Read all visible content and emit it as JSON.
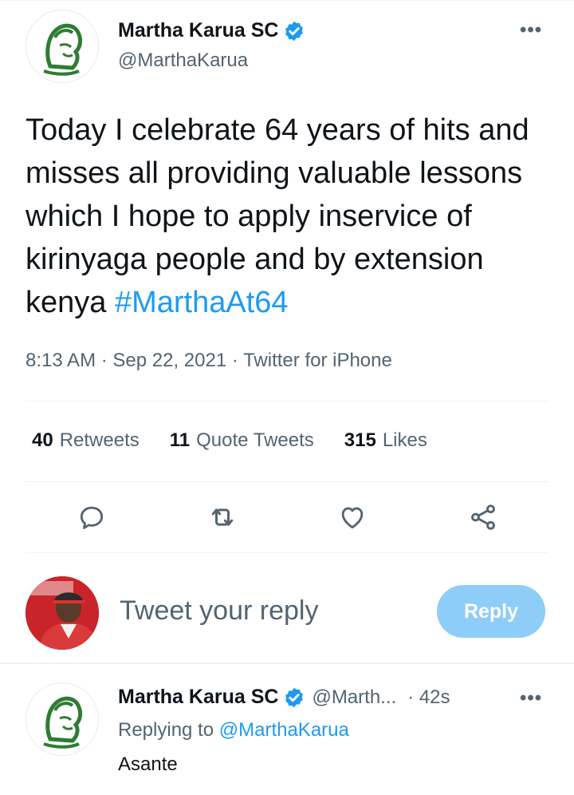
{
  "tweet": {
    "author": {
      "display_name": "Martha Karua SC",
      "handle": "@MarthaKarua"
    },
    "text": "Today I celebrate 64 years of hits and misses all providing valuable lessons which I hope to apply inservice of kirinyaga people and by extension kenya ",
    "hashtag": "#MarthaAt64",
    "time": "8:13 AM",
    "separator": " · ",
    "date": "Sep 22, 2021",
    "source": "Twitter for iPhone",
    "more_icon": "•••",
    "stats": {
      "retweets_count": "40",
      "retweets_label": "Retweets",
      "quotes_count": "11",
      "quotes_label": "Quote Tweets",
      "likes_count": "315",
      "likes_label": "Likes"
    },
    "actions": [
      "reply-icon",
      "retweet-icon",
      "like-icon",
      "share-icon"
    ]
  },
  "composer": {
    "placeholder": "Tweet your reply",
    "reply_button": "Reply"
  },
  "reply": {
    "display_name": "Martha Karua SC",
    "handle": "@Marth...",
    "time": "· 42s",
    "replying_prefix": "Replying to ",
    "replying_to": "@MarthaKarua",
    "text": "Asante",
    "more_icon": "•••"
  },
  "colors": {
    "accent": "#1d9bf0",
    "reply_button": "#8ecdf8",
    "secondary_text": "#536471",
    "avatar_green": "#2e7d32"
  }
}
